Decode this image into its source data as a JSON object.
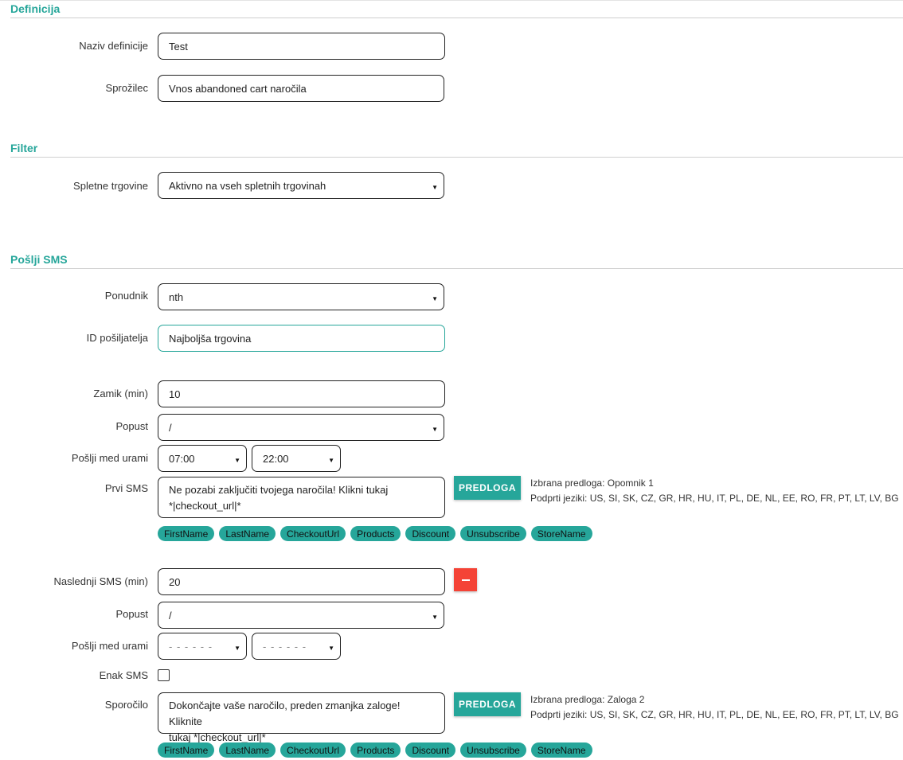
{
  "sections": {
    "definicija": "Definicija",
    "filter": "Filter",
    "sms": "Pošlji SMS"
  },
  "definicija": {
    "naziv_label": "Naziv definicije",
    "naziv_value": "Test",
    "sprozilec_label": "Sprožilec",
    "sprozilec_value": "Vnos abandoned cart naročila"
  },
  "filter": {
    "trgovine_label": "Spletne trgovine",
    "trgovine_value": "Aktivno na vseh spletnih trgovinah"
  },
  "sms": {
    "ponudnik_label": "Ponudnik",
    "ponudnik_value": "nth",
    "sender_label": "ID pošiljatelja",
    "sender_value": "Najboljša trgovina",
    "first": {
      "zamik_label": "Zamik (min)",
      "zamik_value": "10",
      "popust_label": "Popust",
      "popust_value": "/",
      "hours_label": "Pošlji med urami",
      "from_value": "07:00",
      "to_value": "22:00",
      "sms_label": "Prvi SMS",
      "sms_line1": "Ne pozabi zaključiti tvojega naročila! Klikni tukaj",
      "sms_line2": "*|checkout_url|*",
      "template_button": "PREDLOGA",
      "selected_template": "Izbrana predloga: Opomnik 1",
      "languages": "Podprti jeziki: US, SI, SK, CZ, GR, HR, HU, IT, PL, DE, NL, EE, RO, FR, PT, LT, LV, BG"
    },
    "next": {
      "delay_label": "Naslednji SMS (min)",
      "delay_value": "20",
      "popust_label": "Popust",
      "popust_value": "/",
      "hours_label": "Pošlji med urami",
      "from_value": "- - - - - -",
      "to_value": "- - - - - -",
      "same_label": "Enak SMS",
      "message_label": "Sporočilo",
      "msg_line1": "Dokončajte vaše naročilo, preden zmanjka zaloge! Kliknite",
      "msg_line2": "tukaj *|checkout_url|*",
      "template_button": "PREDLOGA",
      "selected_template": "Izbrana predloga: Zaloga 2",
      "languages": "Podprti jeziki: US, SI, SK, CZ, GR, HR, HU, IT, PL, DE, NL, EE, RO, FR, PT, LT, LV, BG"
    },
    "tags": [
      "FirstName",
      "LastName",
      "CheckoutUrl",
      "Products",
      "Discount",
      "Unsubscribe",
      "StoreName"
    ]
  },
  "icons": {
    "caret": "▼",
    "remove": "minus-icon"
  },
  "colors": {
    "accent": "#26a69a",
    "danger": "#f44336"
  }
}
